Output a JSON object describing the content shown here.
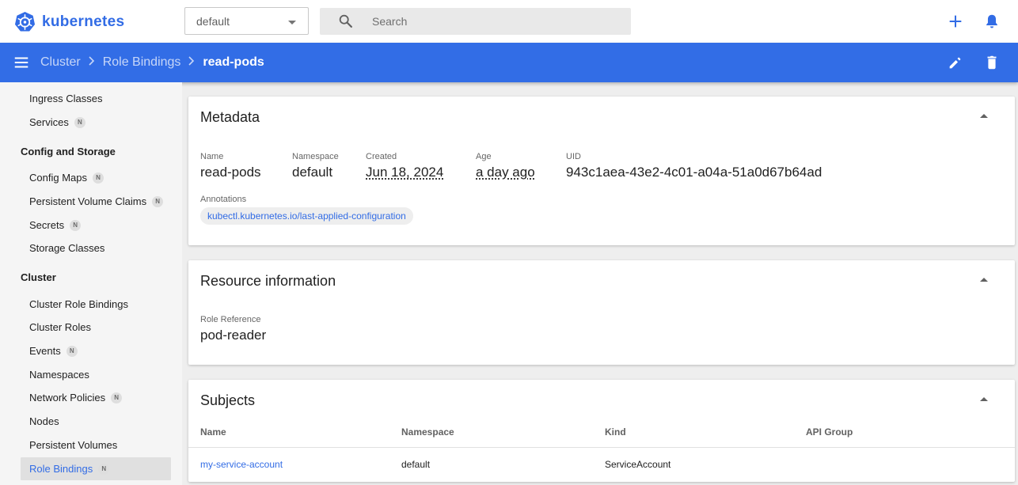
{
  "app": {
    "title": "kubernetes"
  },
  "topbar": {
    "namespace": "default",
    "search_placeholder": "Search",
    "add_icon": "plus-icon",
    "notifications_icon": "bell-icon"
  },
  "breadcrumb": {
    "items": [
      "Cluster",
      "Role Bindings"
    ],
    "current": "read-pods"
  },
  "sidebar": {
    "items": [
      {
        "label": "Ingress Classes",
        "badge": ""
      },
      {
        "label": "Services",
        "badge": "N"
      },
      {
        "label": "Config Maps",
        "badge": "N"
      },
      {
        "label": "Persistent Volume Claims",
        "badge": "N"
      },
      {
        "label": "Secrets",
        "badge": "N"
      },
      {
        "label": "Storage Classes",
        "badge": ""
      },
      {
        "label": "Cluster Role Bindings",
        "badge": ""
      },
      {
        "label": "Cluster Roles",
        "badge": ""
      },
      {
        "label": "Events",
        "badge": "N"
      },
      {
        "label": "Namespaces",
        "badge": ""
      },
      {
        "label": "Network Policies",
        "badge": "N"
      },
      {
        "label": "Nodes",
        "badge": ""
      },
      {
        "label": "Persistent Volumes",
        "badge": ""
      },
      {
        "label": "Role Bindings",
        "badge": "N"
      }
    ],
    "categories": [
      "Config and Storage",
      "Cluster"
    ]
  },
  "metadata": {
    "title": "Metadata",
    "fields": [
      {
        "label": "Name",
        "value": "read-pods"
      },
      {
        "label": "Namespace",
        "value": "default"
      },
      {
        "label": "Created",
        "value": "Jun 18, 2024"
      },
      {
        "label": "Age",
        "value": "a day ago"
      },
      {
        "label": "UID",
        "value": "943c1aea-43e2-4c01-a04a-51a0d67b64ad"
      }
    ],
    "annotations_label": "Annotations",
    "annotation_chip": "kubectl.kubernetes.io/last-applied-configuration"
  },
  "resource": {
    "title": "Resource information",
    "role_reference_label": "Role Reference",
    "role_reference_value": "pod-reader"
  },
  "subjects": {
    "title": "Subjects",
    "columns": [
      "Name",
      "Namespace",
      "Kind",
      "API Group"
    ],
    "rows": [
      {
        "name": "my-service-account",
        "namespace": "default",
        "kind": "ServiceAccount",
        "api_group": ""
      }
    ]
  },
  "colors": {
    "primary": "#326ce5",
    "background": "#eeeeee"
  }
}
